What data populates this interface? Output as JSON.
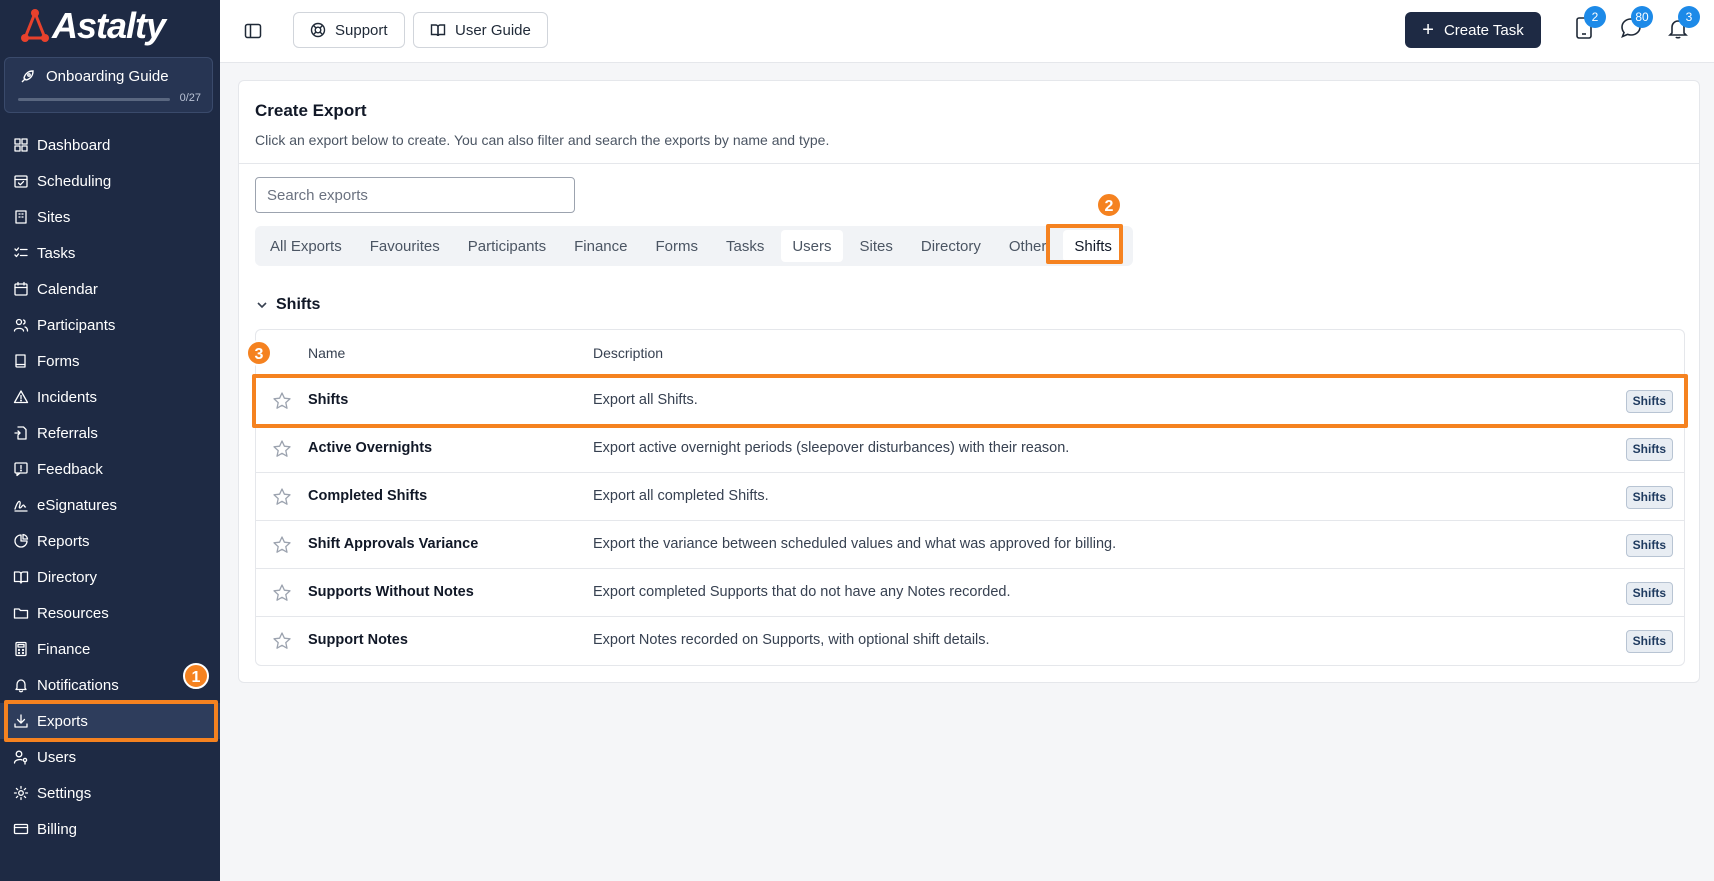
{
  "app": {
    "brand": "Astalty",
    "colors": {
      "sidebar": "#1e2a44",
      "accent": "#f58220",
      "badge": "#1d8ae8",
      "logo": "#e8412c"
    }
  },
  "onboarding": {
    "label": "Onboarding Guide",
    "count": "0/27",
    "progress": 0
  },
  "sidebar": {
    "items": [
      {
        "label": "Dashboard",
        "icon": "dashboard-icon"
      },
      {
        "label": "Scheduling",
        "icon": "calendar-check-icon"
      },
      {
        "label": "Sites",
        "icon": "building-icon"
      },
      {
        "label": "Tasks",
        "icon": "checklist-icon"
      },
      {
        "label": "Calendar",
        "icon": "calendar-icon"
      },
      {
        "label": "Participants",
        "icon": "users-icon"
      },
      {
        "label": "Forms",
        "icon": "book-icon"
      },
      {
        "label": "Incidents",
        "icon": "warning-icon"
      },
      {
        "label": "Referrals",
        "icon": "file-import-icon"
      },
      {
        "label": "Feedback",
        "icon": "message-alert-icon"
      },
      {
        "label": "eSignatures",
        "icon": "signature-icon"
      },
      {
        "label": "Reports",
        "icon": "pie-chart-icon"
      },
      {
        "label": "Directory",
        "icon": "open-book-icon"
      },
      {
        "label": "Resources",
        "icon": "folder-icon"
      },
      {
        "label": "Finance",
        "icon": "calculator-icon"
      },
      {
        "label": "Notifications",
        "icon": "bell-icon"
      },
      {
        "label": "Exports",
        "icon": "download-icon"
      },
      {
        "label": "Users",
        "icon": "user-key-icon"
      },
      {
        "label": "Settings",
        "icon": "gear-icon"
      },
      {
        "label": "Billing",
        "icon": "credit-card-icon"
      }
    ],
    "active": "Exports"
  },
  "topbar": {
    "support_label": "Support",
    "guide_label": "User Guide",
    "create_task_label": "Create Task",
    "badges": {
      "tablet": "2",
      "messages": "80",
      "notifications": "3"
    }
  },
  "annotations": {
    "step1": "1",
    "step2": "2",
    "step3": "3"
  },
  "page": {
    "title": "Create Export",
    "subtitle": "Click an export below to create. You can also filter and search the exports by name and type.",
    "search_placeholder": "Search exports",
    "tabs": [
      "All Exports",
      "Favourites",
      "Participants",
      "Finance",
      "Forms",
      "Tasks",
      "Users",
      "Sites",
      "Directory",
      "Other",
      "Shifts"
    ],
    "selected_tab": "Shifts",
    "section_title": "Shifts",
    "columns": {
      "name": "Name",
      "description": "Description"
    },
    "rows": [
      {
        "name": "Shifts",
        "description": "Export all Shifts.",
        "tag": "Shifts"
      },
      {
        "name": "Active Overnights",
        "description": "Export active overnight periods (sleepover disturbances) with their reason.",
        "tag": "Shifts"
      },
      {
        "name": "Completed Shifts",
        "description": "Export all completed Shifts.",
        "tag": "Shifts"
      },
      {
        "name": "Shift Approvals Variance",
        "description": "Export the variance between scheduled values and what was approved for billing.",
        "tag": "Shifts"
      },
      {
        "name": "Supports Without Notes",
        "description": "Export completed Supports that do not have any Notes recorded.",
        "tag": "Shifts"
      },
      {
        "name": "Support Notes",
        "description": "Export Notes recorded on Supports, with optional shift details.",
        "tag": "Shifts"
      }
    ]
  }
}
